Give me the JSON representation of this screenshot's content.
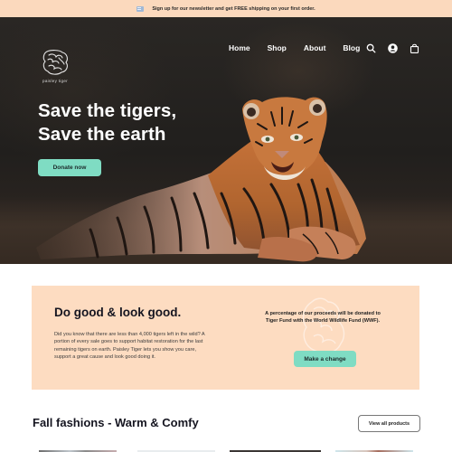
{
  "announcement": {
    "icon": "newsletter-icon",
    "text": "Sign up for our newsletter and get FREE shipping on your first order."
  },
  "brand": {
    "logo_icon": "tiger-logo-icon",
    "name": "paisley tiger"
  },
  "nav": {
    "items": [
      {
        "label": "Home"
      },
      {
        "label": "Shop"
      },
      {
        "label": "About"
      },
      {
        "label": "Blog"
      }
    ],
    "icons": [
      "search-icon",
      "account-icon",
      "shopping-bag-icon"
    ]
  },
  "hero": {
    "title_line1": "Save the tigers,",
    "title_line2": "Save the earth",
    "cta_label": "Donate now",
    "image_alt": "Tiger lying on the ground"
  },
  "do_good": {
    "heading": "Do good & look good.",
    "body": "Did you know that there are less than 4,000 tigers left in the wild?  A portion of every sale goes to support habitat restoration for the last remaining tigers on earth. Paisley Tiger lets you show you care, support a great cause and look good doing it.",
    "proceeds_text": "A percentage of our proceeds will be donated to Tiger Fund with the World Wildlife Fund (WWF).",
    "cta_label": "Make a change"
  },
  "products_section": {
    "title": "Fall fashions - Warm & Comfy",
    "view_all_label": "View all products"
  },
  "colors": {
    "announcement_bg": "#fbd9bd",
    "accent_mint": "#7fdcc3",
    "section_peach": "#fddcc1",
    "heading_dark": "#151520"
  }
}
